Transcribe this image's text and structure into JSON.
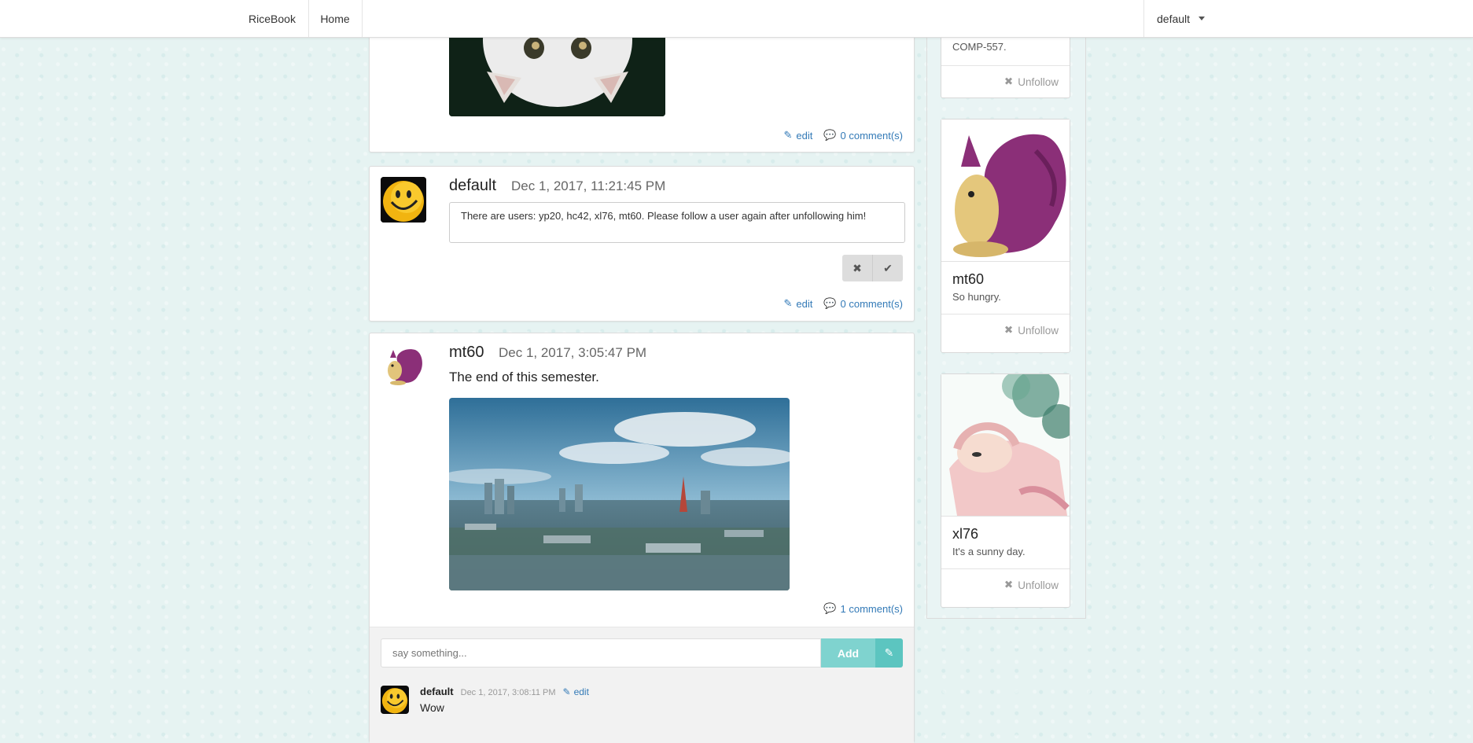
{
  "navbar": {
    "brand": "RiceBook",
    "home": "Home",
    "user": "default"
  },
  "posts": [
    {
      "edit_label": "edit",
      "comments_label": "0 comment(s)"
    },
    {
      "author": "default",
      "date": "Dec 1, 2017, 11:21:45 PM",
      "edit_text": "There are users: yp20, hc42, xl76, mt60. Please follow a user again after unfollowing him!",
      "edit_label": "edit",
      "comments_label": "0 comment(s)"
    },
    {
      "author": "mt60",
      "date": "Dec 1, 2017, 3:05:47 PM",
      "text": "The end of this semester.",
      "comments_label": "1 comment(s)",
      "comment_input_placeholder": "say something...",
      "add_label": "Add",
      "comment": {
        "author": "default",
        "date": "Dec 1, 2017, 3:08:11 PM",
        "edit_label": "edit",
        "text": "Wow"
      }
    }
  ],
  "following": [
    {
      "status": "COMP-557.",
      "unfollow_label": "Unfollow"
    },
    {
      "name": "mt60",
      "status": "So hungry.",
      "unfollow_label": "Unfollow"
    },
    {
      "name": "xl76",
      "status": "It's a sunny day.",
      "unfollow_label": "Unfollow"
    }
  ],
  "colors": {
    "link": "#337ab7",
    "accent": "#7fd3cf",
    "accent_dark": "#5cc5c0"
  }
}
